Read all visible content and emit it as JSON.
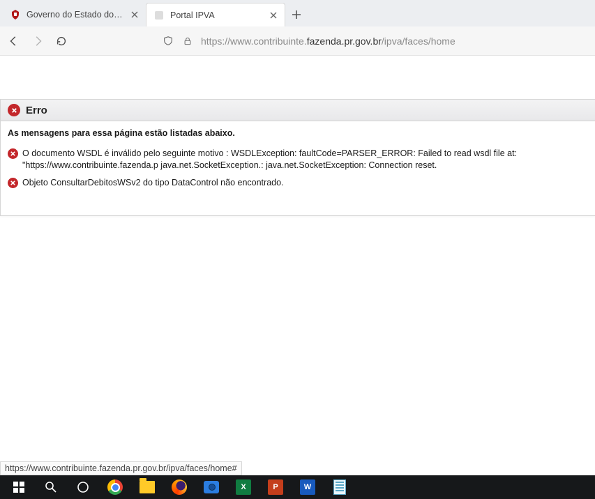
{
  "browser": {
    "tabs": [
      {
        "title": "Governo do Estado do Paraná",
        "active": false
      },
      {
        "title": "Portal IPVA",
        "active": true
      }
    ],
    "url_prefix": "https://www.contribuinte.",
    "url_domain": "fazenda.pr.gov.br",
    "url_suffix": "/ipva/faces/home"
  },
  "error_panel": {
    "title": "Erro",
    "subtitle": "As mensagens para essa página estão listadas abaixo.",
    "messages": [
      "O documento WSDL é inválido pelo seguinte motivo : WSDLException: faultCode=PARSER_ERROR: Failed to read wsdl file at: \"https://www.contribuinte.fazenda.p java.net.SocketException.: java.net.SocketException: Connection reset.",
      "Objeto ConsultarDebitosWSv2 do tipo DataControl não encontrado."
    ]
  },
  "status_bar": "https://www.contribuinte.fazenda.pr.gov.br/ipva/faces/home#",
  "taskbar": {
    "excel_letter": "X",
    "powerpoint_letter": "P",
    "word_letter": "W"
  }
}
